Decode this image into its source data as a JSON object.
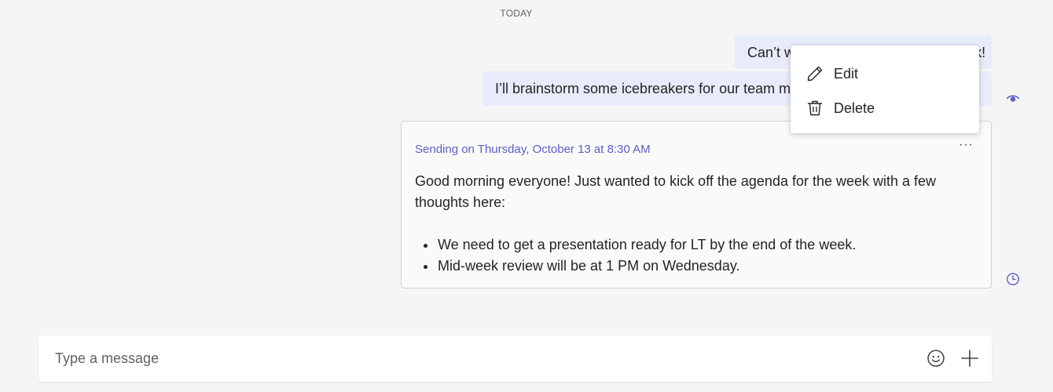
{
  "divider": {
    "label": "TODAY"
  },
  "messages": [
    {
      "text": "Can’t wait to see everyone next week!"
    },
    {
      "text": "I’ll brainstorm some icebreakers for our team meeting on Tuesday."
    }
  ],
  "scheduled": {
    "sending_label": "Sending on Thursday, October 13 at 8:30 AM",
    "more_label": "···",
    "body": "Good morning everyone! Just wanted to kick off the agenda for the week with a few thoughts here:",
    "bullets": [
      "We need to get a presentation ready for LT by the end of the week.",
      "Mid-week review will be at 1 PM on Wednesday."
    ]
  },
  "menu": {
    "items": [
      {
        "label": "Edit",
        "icon": "pencil-icon"
      },
      {
        "label": "Delete",
        "icon": "trash-icon"
      }
    ]
  },
  "compose": {
    "placeholder": "Type a message",
    "emoji_icon": "emoji-icon",
    "add_icon": "plus-icon"
  },
  "colors": {
    "accent": "#5b5fc7",
    "bubble": "#e8ebfa",
    "background": "#f5f5f5"
  }
}
